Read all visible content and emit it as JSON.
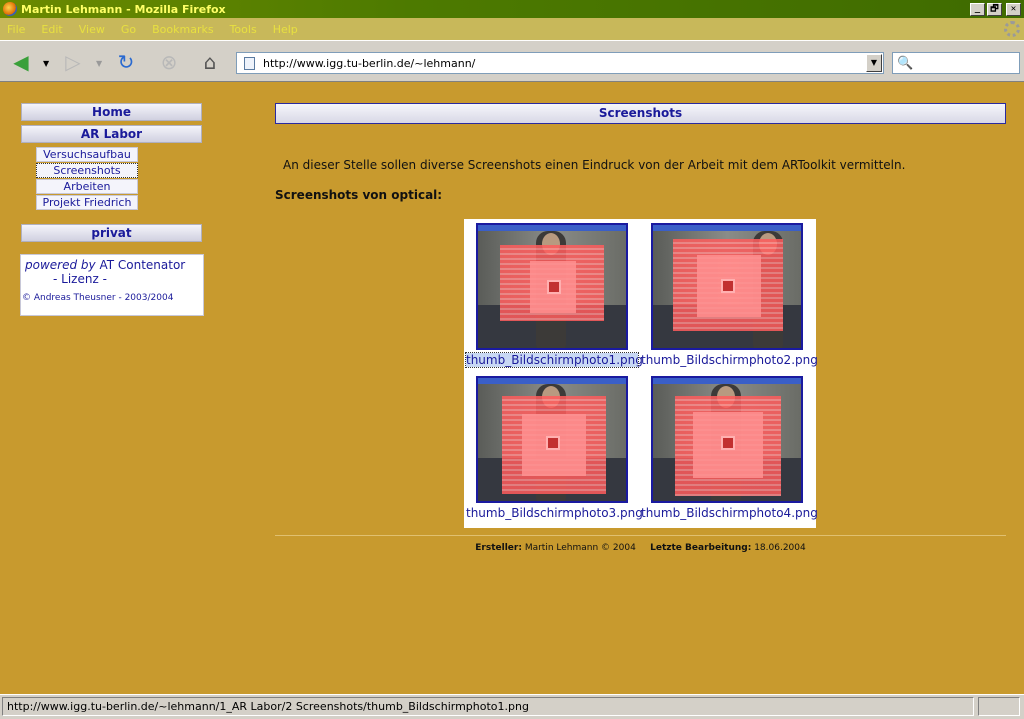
{
  "window": {
    "title": "Martin Lehmann - Mozilla Firefox",
    "min": "_",
    "max": "🗗",
    "close": "✕"
  },
  "menu": [
    "File",
    "Edit",
    "View",
    "Go",
    "Bookmarks",
    "Tools",
    "Help"
  ],
  "toolbar": {
    "url": "http://www.igg.tu-berlin.de/~lehmann/",
    "icons": [
      "back-icon",
      "forward-icon",
      "reload-icon",
      "stop-icon",
      "home-icon",
      "search-icon"
    ]
  },
  "sidebar": {
    "home": "Home",
    "ar_labor": "AR Labor",
    "sub": [
      "Versuchsaufbau",
      "Screenshots",
      "Arbeiten",
      "Projekt Friedrich"
    ],
    "privat": "privat",
    "powered_prefix": "powered by",
    "powered_name": "AT Contenator",
    "license": "- Lizenz -",
    "copyright": "© Andreas Theusner - 2003/2004"
  },
  "main": {
    "header": "Screenshots",
    "intro": "An dieser Stelle sollen diverse Screenshots einen Eindruck von der Arbeit mit dem ARToolkit vermitteln.",
    "subheading": "Screenshots von optical:",
    "thumbs": [
      "thumb_Bildschirmphoto1.png",
      "thumb_Bildschirmphoto2.png",
      "thumb_Bildschirmphoto3.png",
      "thumb_Bildschirmphoto4.png"
    ]
  },
  "footer": {
    "creator_label": "Ersteller:",
    "creator": "Martin Lehmann © 2004",
    "edit_label": "Letzte Bearbeitung:",
    "edit_date": "18.06.2004"
  },
  "status": "http://www.igg.tu-berlin.de/~lehmann/1_AR Labor/2 Screenshots/thumb_Bildschirmphoto1.png",
  "colors": {
    "page_bg": "#c89a2e",
    "link": "#1a1a9a",
    "titlebar": "#4d7a00"
  }
}
